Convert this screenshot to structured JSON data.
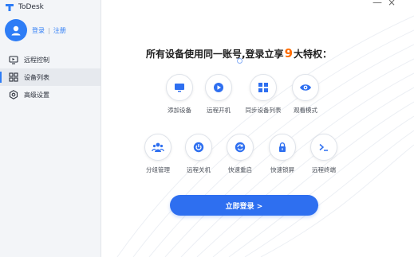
{
  "app": {
    "title": "ToDesk"
  },
  "window": {
    "minimize": "—",
    "close": "×"
  },
  "user": {
    "login": "登录",
    "separator": "|",
    "register": "注册"
  },
  "nav": {
    "items": [
      {
        "label": "远程控制",
        "icon": "monitor-icon"
      },
      {
        "label": "设备列表",
        "icon": "grid-icon",
        "active": true
      },
      {
        "label": "高级设置",
        "icon": "gear-icon"
      }
    ]
  },
  "promo": {
    "headline_before": "所有设备使用同一账号,登录立享",
    "count": "9",
    "headline_after": "大特权："
  },
  "features": [
    {
      "label": "添加设备",
      "icon": "monitor-icon"
    },
    {
      "label": "远程开机",
      "icon": "play-icon"
    },
    {
      "label": "同步设备列表",
      "icon": "grid-icon"
    },
    {
      "label": "观看模式",
      "icon": "eye-icon"
    },
    {
      "label": "分组管理",
      "icon": "group-icon"
    },
    {
      "label": "远程关机",
      "icon": "power-icon"
    },
    {
      "label": "快速重启",
      "icon": "restart-icon"
    },
    {
      "label": "快速锁屏",
      "icon": "lock-icon"
    },
    {
      "label": "远程终端",
      "icon": "terminal-icon"
    }
  ],
  "cta": {
    "label": "立即登录 >"
  },
  "colors": {
    "accent": "#2e6ff0",
    "highlight": "#ff6d00",
    "sidebar_bg": "#f3f5f8"
  }
}
